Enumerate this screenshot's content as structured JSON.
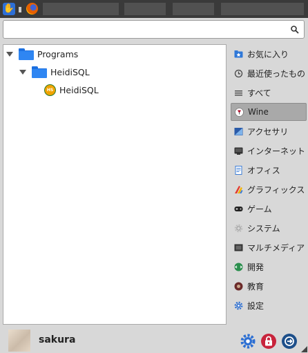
{
  "search": {
    "value": "",
    "placeholder": ""
  },
  "tree": [
    {
      "label": "Programs",
      "type": "folder",
      "expanded": true
    },
    {
      "label": "HeidiSQL",
      "type": "folder",
      "expanded": true
    },
    {
      "label": "HeidiSQL",
      "type": "application",
      "icon": "heidisql-icon"
    }
  ],
  "categories": [
    {
      "label": "お気に入り",
      "icon": "favorites-icon",
      "selected": false
    },
    {
      "label": "最近使ったもの",
      "icon": "clock-icon",
      "selected": false
    },
    {
      "label": "すべて",
      "icon": "list-icon",
      "selected": false
    },
    {
      "label": "Wine",
      "icon": "wine-icon",
      "selected": true
    },
    {
      "label": "アクセサリ",
      "icon": "accessories-icon",
      "selected": false
    },
    {
      "label": "インターネット",
      "icon": "internet-icon",
      "selected": false
    },
    {
      "label": "オフィス",
      "icon": "office-icon",
      "selected": false
    },
    {
      "label": "グラフィックス",
      "icon": "graphics-icon",
      "selected": false
    },
    {
      "label": "ゲーム",
      "icon": "gamepad-icon",
      "selected": false
    },
    {
      "label": "システム",
      "icon": "system-gear-icon",
      "selected": false
    },
    {
      "label": "マルチメディア",
      "icon": "multimedia-icon",
      "selected": false
    },
    {
      "label": "開発",
      "icon": "development-icon",
      "selected": false
    },
    {
      "label": "教育",
      "icon": "education-icon",
      "selected": false
    },
    {
      "label": "設定",
      "icon": "settings-icon",
      "selected": false
    }
  ],
  "user": {
    "name": "sakura"
  },
  "colors": {
    "accent": "#2f86f2",
    "lock": "#c8243c",
    "logout": "#1d4f8a",
    "settings": "#2c6fd3"
  }
}
